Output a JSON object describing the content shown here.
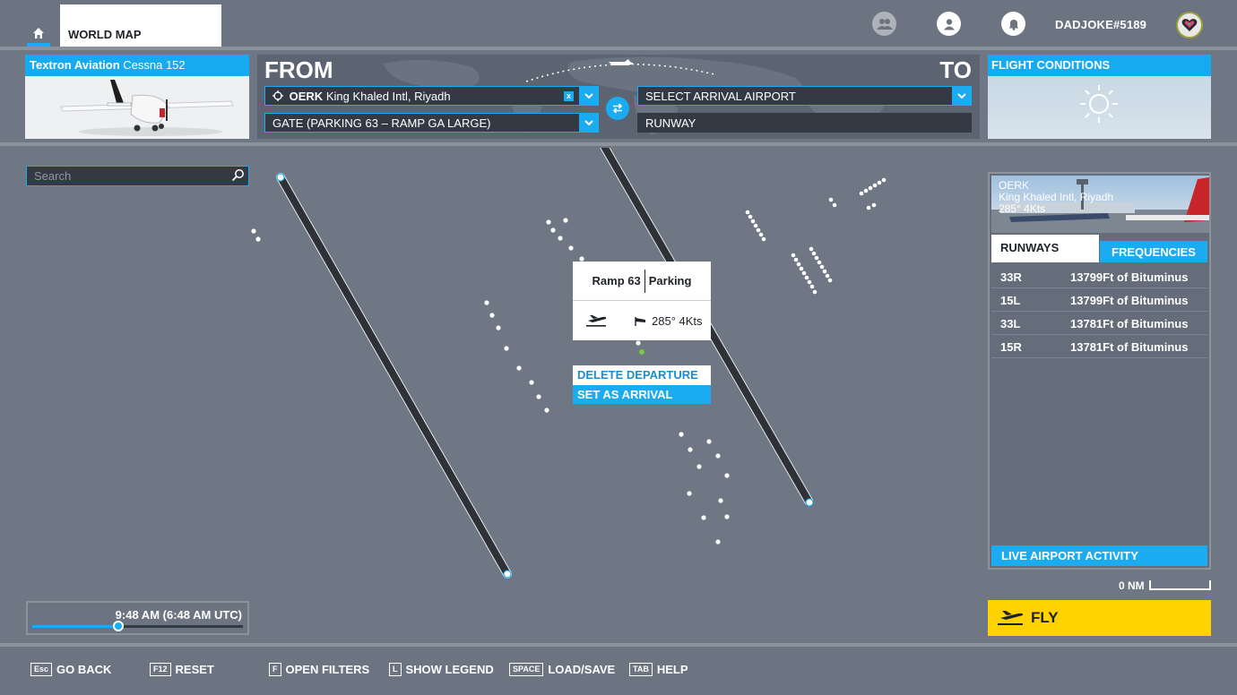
{
  "header": {
    "tab_label": "WORLD MAP",
    "username": "DADJOKE#5189"
  },
  "aircraft": {
    "brand": "Textron Aviation",
    "model": "Cessna 152"
  },
  "route": {
    "from_label": "FROM",
    "to_label": "TO",
    "departure_code": "OERK",
    "departure_name": "King Khaled Intl, Riyadh",
    "departure_clear": "x",
    "departure_spot": "GATE (PARKING 63 – RAMP GA LARGE)",
    "arrival_placeholder": "SELECT ARRIVAL AIRPORT",
    "arrival_runway": "RUNWAY"
  },
  "conditions": {
    "title": "FLIGHT CONDITIONS",
    "weather_icon": "sun-icon"
  },
  "map": {
    "search_placeholder": "Search",
    "popup": {
      "spot": "Ramp 63",
      "type": "Parking",
      "wind": "285° 4Kts"
    },
    "delete_departure": "DELETE DEPARTURE",
    "set_arrival": "SET AS ARRIVAL"
  },
  "airport": {
    "code": "OERK",
    "name": "King Khaled Intl, Riyadh",
    "wind": "285° 4Kts",
    "tab_runways": "RUNWAYS",
    "tab_frequencies": "FREQUENCIES",
    "runways": [
      {
        "id": "33R",
        "info": "13799Ft of Bituminus"
      },
      {
        "id": "15L",
        "info": "13799Ft of Bituminus"
      },
      {
        "id": "33L",
        "info": "13781Ft of Bituminus"
      },
      {
        "id": "15R",
        "info": "13781Ft of Bituminus"
      }
    ],
    "live_activity": "LIVE AIRPORT ACTIVITY"
  },
  "scale": {
    "label": "0 NM"
  },
  "fly_label": "FLY",
  "time": {
    "label": "9:48 AM (6:48 AM UTC)",
    "progress": 0.41
  },
  "hints": [
    {
      "key": "Esc",
      "label": "GO BACK"
    },
    {
      "key": "F12",
      "label": "RESET"
    },
    {
      "key": "F",
      "label": "OPEN FILTERS"
    },
    {
      "key": "L",
      "label": "SHOW LEGEND"
    },
    {
      "key": "SPACE",
      "label": "LOAD/SAVE"
    },
    {
      "key": "TAB",
      "label": "HELP"
    }
  ],
  "colors": {
    "accent": "#1aabf0",
    "fly": "#ffd200",
    "background": "#6e7783"
  }
}
